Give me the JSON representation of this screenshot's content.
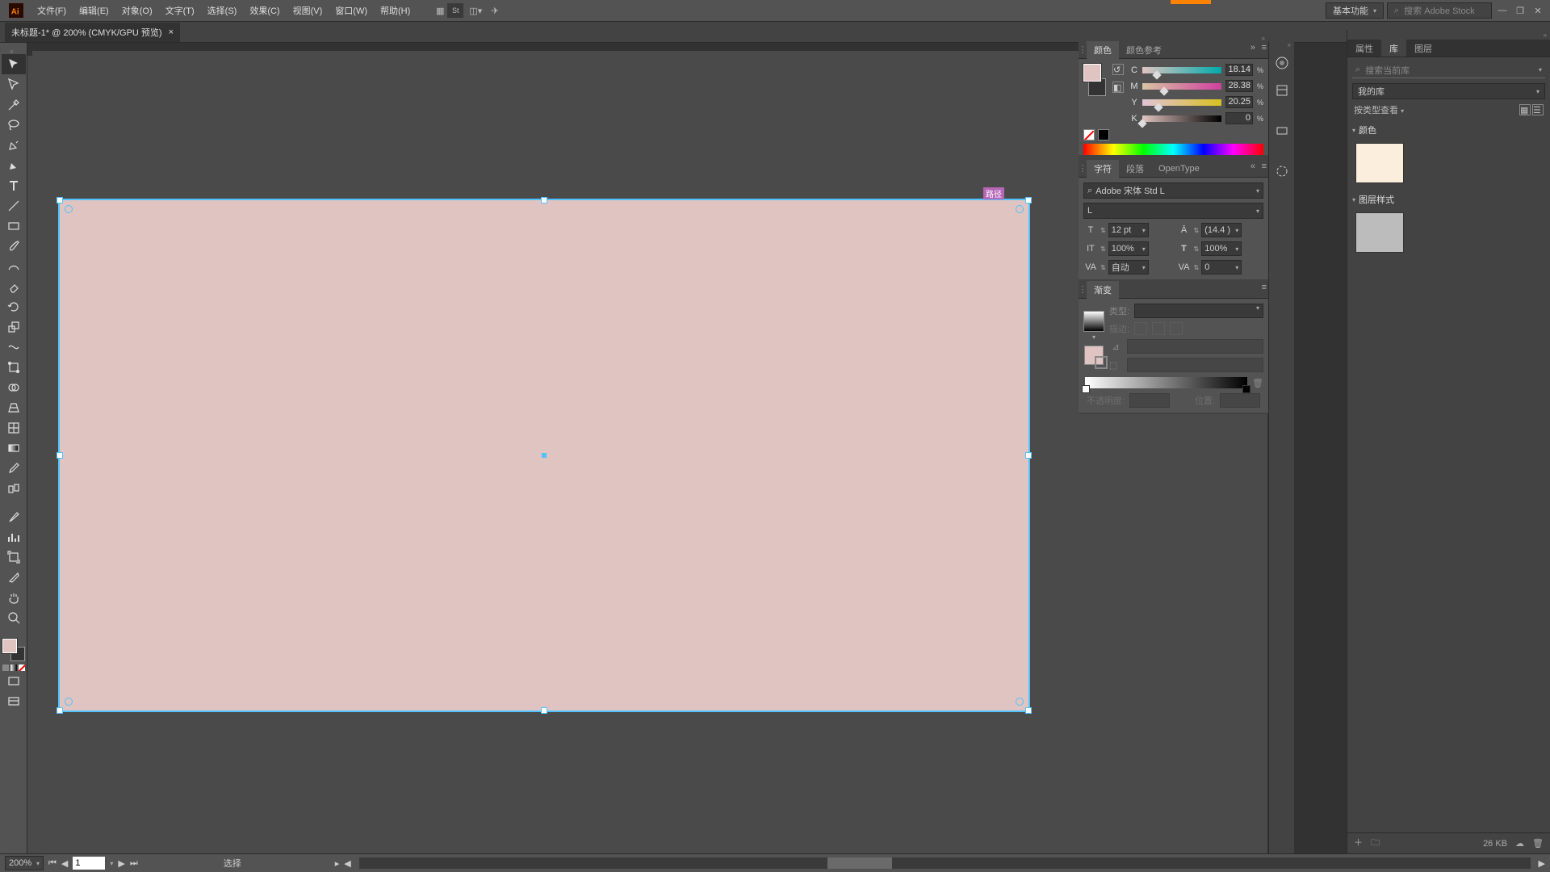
{
  "menubar": {
    "items": [
      "文件(F)",
      "编辑(E)",
      "对象(O)",
      "文字(T)",
      "选择(S)",
      "效果(C)",
      "视图(V)",
      "窗口(W)",
      "帮助(H)"
    ],
    "workspace": "基本功能",
    "stock_placeholder": "搜索 Adobe Stock"
  },
  "doc_tab": {
    "title": "未标题-1* @ 200% (CMYK/GPU 预览)"
  },
  "path_label": "路径",
  "color": {
    "tabs": [
      "颜色",
      "颜色参考"
    ],
    "labels": [
      "C",
      "M",
      "Y",
      "K"
    ],
    "values": [
      "18.14",
      "28.38",
      "20.25",
      "0"
    ],
    "pct": "%"
  },
  "char": {
    "tabs": [
      "字符",
      "段落",
      "OpenType"
    ],
    "font": "Adobe 宋体 Std L",
    "style": "L",
    "size": "12 pt",
    "leading": "(14.4 )",
    "hscale": "100%",
    "vscale": "100%",
    "kerning": "自动",
    "tracking": "0"
  },
  "grad": {
    "tab": "渐变",
    "type_label": "类型:",
    "stroke_label": "描边:",
    "opacity_label": "不透明度:",
    "position_label": "位置:"
  },
  "lib": {
    "tabs": [
      "属性",
      "库",
      "图层"
    ],
    "search_placeholder": "搜索当前库",
    "selector": "我的库",
    "display": "按类型查看",
    "sect_colors": "颜色",
    "sect_styles": "图层样式",
    "filesize": "26 KB"
  },
  "status": {
    "zoom": "200%",
    "page": "1",
    "mode": "选择"
  }
}
